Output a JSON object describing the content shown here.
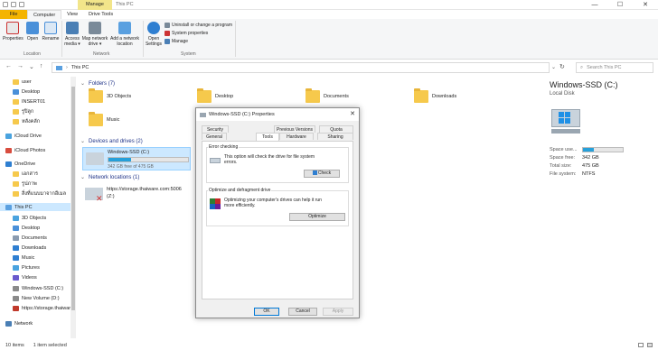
{
  "window": {
    "title": "This PC",
    "context_tab": "Manage",
    "controls": {
      "minimize": "—",
      "maximize": "☐",
      "close": "✕"
    }
  },
  "ribbon_tabs": [
    "File",
    "Computer",
    "View",
    "Drive Tools"
  ],
  "ribbon": {
    "location": {
      "label": "Location",
      "buttons": [
        "Properties",
        "Open",
        "Rename"
      ]
    },
    "network": {
      "label": "Network",
      "buttons": [
        "Access media ▾",
        "Map network drive ▾",
        "Add a network location"
      ]
    },
    "system": {
      "label": "System",
      "open_settings": "Open Settings",
      "items": [
        "Uninstall or change a program",
        "System properties",
        "Manage"
      ]
    }
  },
  "address": {
    "path": "This PC",
    "search_placeholder": "Search This PC"
  },
  "nav_pane": {
    "items": [
      {
        "label": "user",
        "color": "#f6c94c",
        "indent": 1
      },
      {
        "label": "Desktop",
        "color": "#4a90d9",
        "indent": 1
      },
      {
        "label": "INSERT01",
        "color": "#f6c94c",
        "indent": 1
      },
      {
        "label": "รูปิลูก",
        "color": "#f6c94c",
        "indent": 1
      },
      {
        "label": "หลังคลัก",
        "color": "#f6c94c",
        "indent": 1
      },
      {
        "label": "iCloud Drive",
        "color": "#4aa3df",
        "indent": 0
      },
      {
        "label": "iCloud Photos",
        "color": "#d84c3e",
        "indent": 0
      },
      {
        "label": "OneDrive",
        "color": "#2f7fd1",
        "indent": 0
      },
      {
        "label": "เอกสาร",
        "color": "#f6c94c",
        "indent": 1
      },
      {
        "label": "รูปภาพ",
        "color": "#f6c94c",
        "indent": 1
      },
      {
        "label": "สิ่งที่แนบมาจากอีเมล",
        "color": "#f6c94c",
        "indent": 1
      },
      {
        "label": "This PC",
        "color": "#5aa0e0",
        "indent": 0,
        "selected": true
      },
      {
        "label": "3D Objects",
        "color": "#4aa3df",
        "indent": 1
      },
      {
        "label": "Desktop",
        "color": "#4a90d9",
        "indent": 1
      },
      {
        "label": "Documents",
        "color": "#8a9bb0",
        "indent": 1
      },
      {
        "label": "Downloads",
        "color": "#2f7fd1",
        "indent": 1
      },
      {
        "label": "Music",
        "color": "#2f7fd1",
        "indent": 1
      },
      {
        "label": "Pictures",
        "color": "#4aa3df",
        "indent": 1
      },
      {
        "label": "Videos",
        "color": "#6a5acd",
        "indent": 1
      },
      {
        "label": "Windows-SSD (C:)",
        "color": "#8a8a8a",
        "indent": 1
      },
      {
        "label": "New Volume (D:)",
        "color": "#8a8a8a",
        "indent": 1
      },
      {
        "label": "https://storage.thaiware",
        "color": "#c0392b",
        "indent": 1
      },
      {
        "label": "Network",
        "color": "#4a7fb5",
        "indent": 0
      }
    ]
  },
  "content": {
    "folders_header": "Folders (7)",
    "folders": [
      "3D Objects",
      "Desktop",
      "Documents",
      "Downloads",
      "Music"
    ],
    "devices_header": "Devices and drives (2)",
    "drive": {
      "name": "Windows-SSD (C:)",
      "free": "342 GB free of 475 GB",
      "used_fraction": 0.28
    },
    "network_header": "Network locations (1)",
    "network_location": {
      "line1": "https://storage.thaiware.com:5006",
      "line2": "(Z:)"
    }
  },
  "details": {
    "title": "Windows-SSD (C:)",
    "subtitle": "Local Disk",
    "used_fraction": 0.28,
    "rows": [
      {
        "k": "Space use...",
        "v": ""
      },
      {
        "k": "Space free:",
        "v": "342 GB"
      },
      {
        "k": "Total size:",
        "v": "475 GB"
      },
      {
        "k": "File system:",
        "v": "NTFS"
      }
    ]
  },
  "status": {
    "count": "10 items",
    "selected": "1 item selected"
  },
  "dialog": {
    "title": "Windows-SSD (C:) Properties",
    "tabs_row1": [
      "Security",
      "Previous Versions",
      "Quota"
    ],
    "tabs_row2": [
      "General",
      "Tools",
      "Hardware",
      "Sharing"
    ],
    "error_checking": {
      "legend": "Error checking",
      "text": "This option will check the drive for file system errors.",
      "button": "Check"
    },
    "optimize": {
      "legend": "Optimize and defragment drive",
      "text": "Optimizing your computer's drives can help it run more efficiently.",
      "button": "Optimize"
    },
    "buttons": {
      "ok": "OK",
      "cancel": "Cancel",
      "apply": "Apply"
    }
  }
}
